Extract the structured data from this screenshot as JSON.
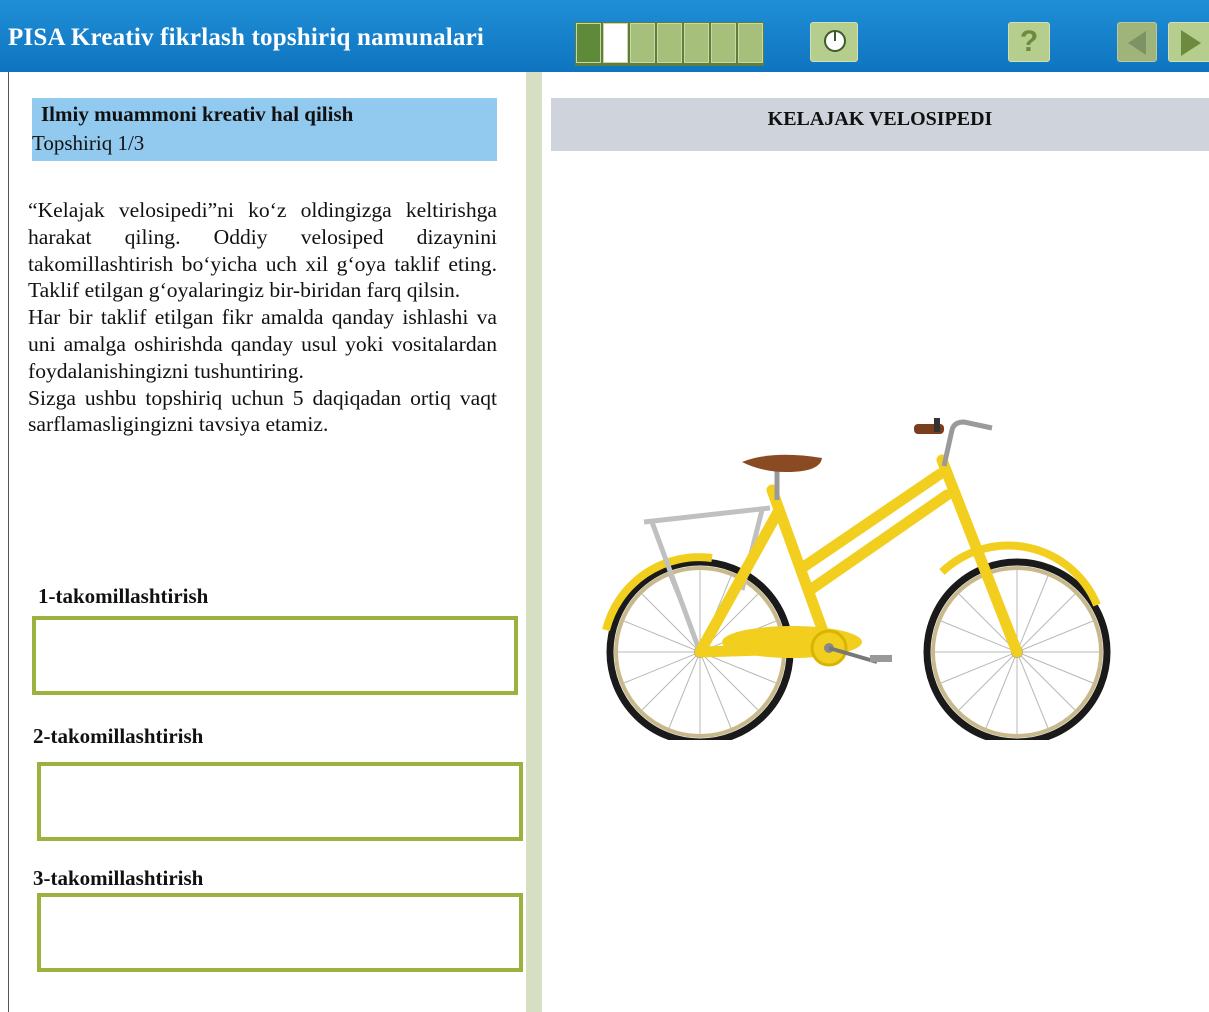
{
  "app": {
    "title": "PISA Kreativ fikrlash topshiriq namunalari"
  },
  "progress": {
    "total_cells": 7,
    "completed": 1,
    "current_index": 1
  },
  "toolbar": {
    "timer_icon": "clock-icon",
    "help_label": "?",
    "help_icon": "help-icon",
    "prev_icon": "arrow-left-icon",
    "next_icon": "arrow-right-icon"
  },
  "task": {
    "title": "Ilmiy muammoni kreativ hal qilish",
    "counter": "Topshiriq 1/3",
    "paragraphs": [
      "“Kelajak velosipedi”ni ko‘z oldingizga keltirishga harakat qiling. Oddiy velosiped dizaynini takomillashtirish bo‘yicha uch xil g‘oya taklif eting. Taklif etilgan g‘oyalaringiz bir-biridan farq qilsin.",
      "Har bir taklif etilgan fikr amalda qanday ishlashi va uni amalga oshirishda qanday usul yoki vositalardan foydalanishingizni tushuntiring.",
      "Sizga ushbu topshiriq uchun 5 daqiqadan ortiq vaqt sarflamasligingizni tavsiya etamiz."
    ]
  },
  "improvements": [
    {
      "label": "1-takomillashtirish",
      "value": ""
    },
    {
      "label": "2-takomillashtirish",
      "value": ""
    },
    {
      "label": "3-takomillashtirish",
      "value": ""
    }
  ],
  "stimulus": {
    "title": "KELAJAK VELOSIPEDI",
    "image": "yellow-bicycle-image"
  },
  "colors": {
    "topbar": "#1480cc",
    "task_header": "#92c9ee",
    "answer_border": "#9cb23f",
    "bike_frame": "#f2cf1f",
    "stimulus_header": "#cfd3db"
  }
}
